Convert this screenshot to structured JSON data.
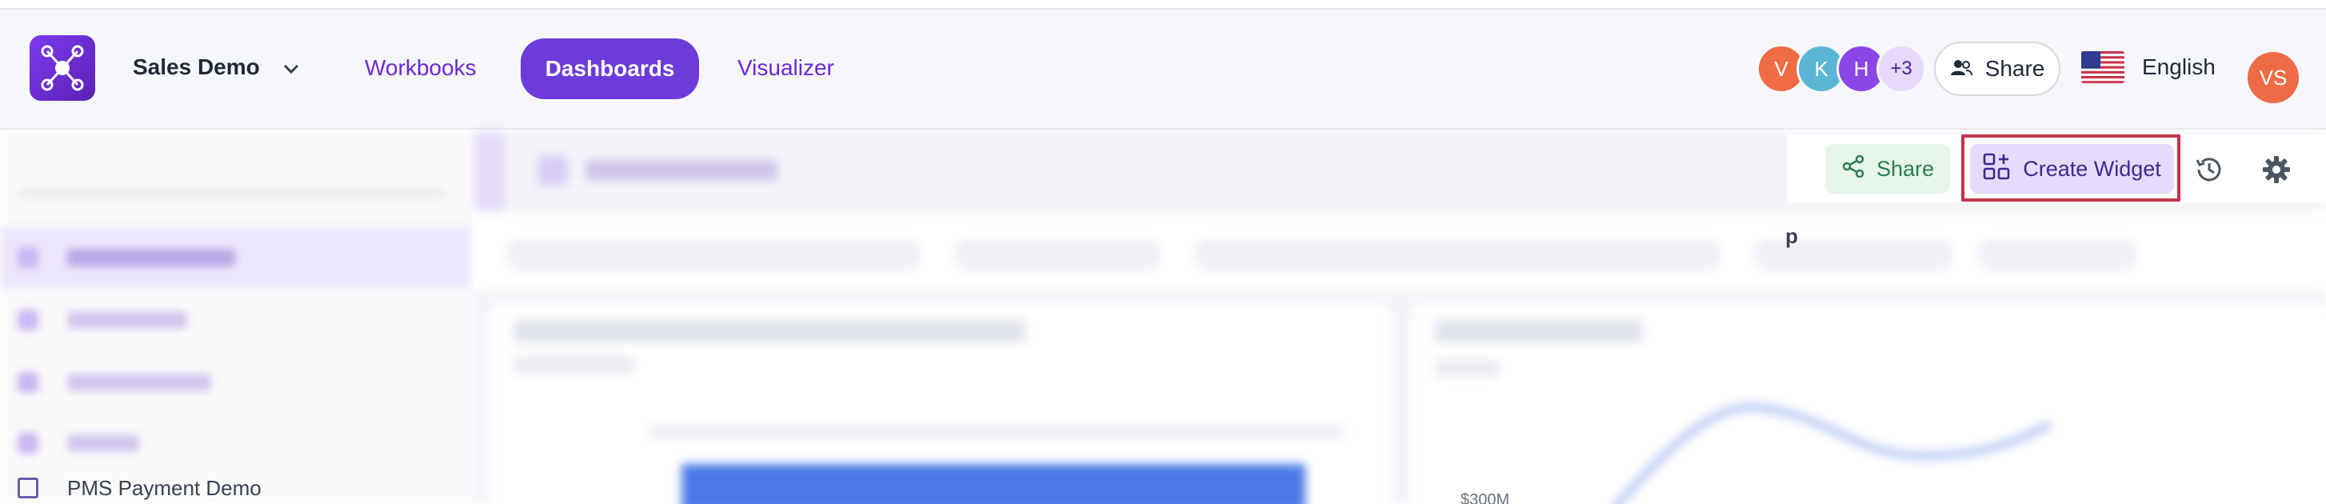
{
  "header": {
    "project_name": "Sales Demo",
    "nav": {
      "workbooks": "Workbooks",
      "dashboards": "Dashboards",
      "visualizer": "Visualizer"
    },
    "collaborators": [
      {
        "initial": "V",
        "color": "#ef6c44"
      },
      {
        "initial": "K",
        "color": "#5bb6d6"
      },
      {
        "initial": "H",
        "color": "#8b46e6"
      }
    ],
    "collaborators_more": "+3",
    "share_label": "Share",
    "language": "English",
    "user_initials": "VS"
  },
  "toolbar": {
    "share_label": "Share",
    "create_widget_label": "Create Widget"
  },
  "sidebar": {
    "partial_item_label": "PMS Payment Demo"
  },
  "filters": {
    "partial_chip_text": "p"
  },
  "chart": {
    "partial_axis_label": "$300M"
  }
}
